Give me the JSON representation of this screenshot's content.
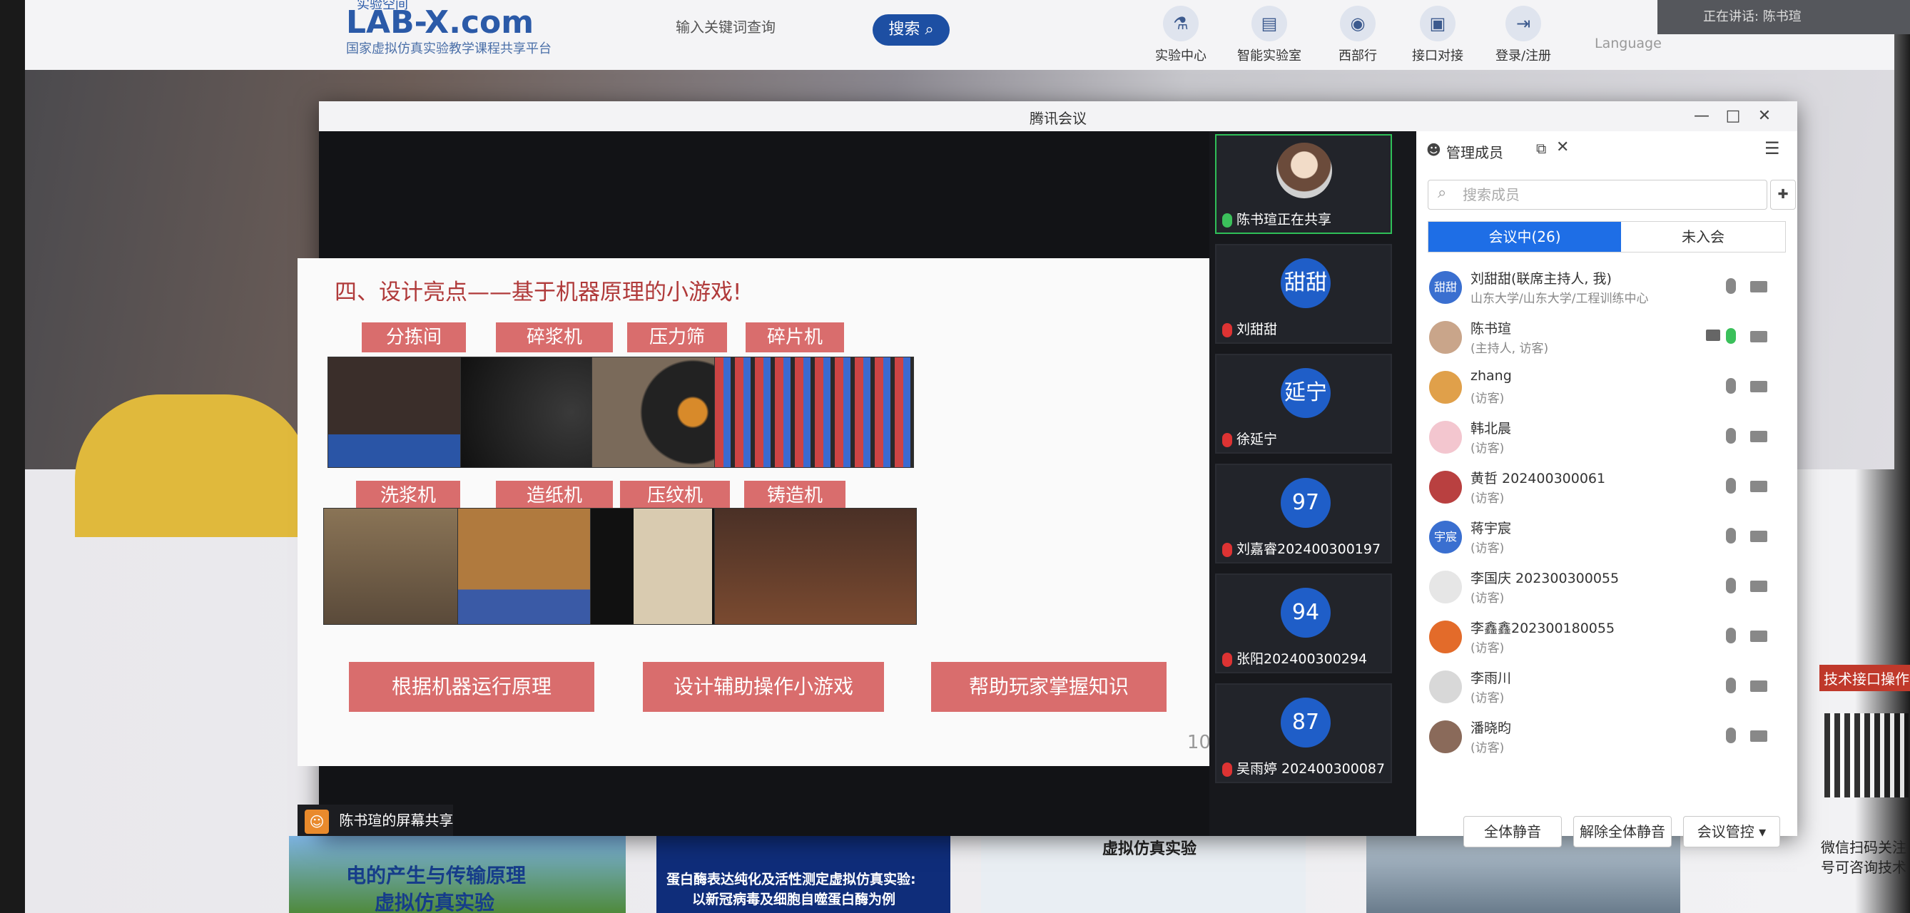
{
  "site": {
    "logo_top": "实验空间",
    "logo": "LAB-X.com",
    "logo_sub": "国家虚拟仿真实验教学课程共享平台",
    "search_placeholder": "输入关键词查询",
    "search_button": "搜索",
    "nav": [
      "实验中心",
      "智能实验室",
      "西部行",
      "接口对接",
      "登录/注册"
    ],
    "language": "Language",
    "live_text": "正在讲话: 陈书瑄",
    "cards": [
      {
        "line1": "电的产生与传输原理",
        "line2": "虚拟仿真实验"
      },
      {
        "line1": "蛋白酶表达纯化及活性测定虚拟仿真实验:",
        "line2": "以新冠病毒及细胞自噬蛋白酶为例"
      },
      {
        "line1": "虚拟仿真实验",
        "line2": ""
      }
    ],
    "right_strip": "技术接口操作说",
    "qr_caption_1": "微信扫码关注",
    "qr_caption_2": "号可咨询技术"
  },
  "meeting": {
    "window_title": "腾讯会议",
    "share_label": "陈书瑄的屏幕共享",
    "slide": {
      "title": "四、设计亮点——基于机器原理的小游戏!",
      "games": [
        "分拣间",
        "碎浆机",
        "压力筛",
        "碎片机",
        "洗浆机",
        "造纸机",
        "压纹机",
        "铸造机"
      ],
      "footer_buttons": [
        "根据机器运行原理",
        "设计辅助操作小游戏",
        "帮助玩家掌握知识"
      ],
      "page": "10"
    },
    "tiles": [
      {
        "avatar": "",
        "name": "陈书瑄正在共享",
        "mic_on": true
      },
      {
        "avatar": "甜甜",
        "name": "刘甜甜",
        "mic_on": false
      },
      {
        "avatar": "延宁",
        "name": "徐延宁",
        "mic_on": false
      },
      {
        "avatar": "97",
        "name": "刘嘉睿202400300197",
        "mic_on": false
      },
      {
        "avatar": "94",
        "name": "张阳202400300294",
        "mic_on": false
      },
      {
        "avatar": "87",
        "name": "吴雨婷 202400300087",
        "mic_on": false
      }
    ],
    "members_panel": {
      "title": "管理成员",
      "search_placeholder": "搜索成员",
      "tab_in": "会议中(26)",
      "tab_out": "未入会",
      "members": [
        {
          "avatar": "甜甜",
          "name": "刘甜甜(联席主持人, 我)",
          "role": "山东大学/山东大学/工程训练中心",
          "mic_on": false
        },
        {
          "avatar": "",
          "name": "陈书瑄",
          "role": "(主持人, 访客)",
          "mic_on": true
        },
        {
          "avatar": "",
          "name": "zhang",
          "role": "(访客)",
          "mic_on": false
        },
        {
          "avatar": "",
          "name": "韩北晨",
          "role": "(访客)",
          "mic_on": false
        },
        {
          "avatar": "",
          "name": "黄哲 202400300061",
          "role": "(访客)",
          "mic_on": false
        },
        {
          "avatar": "宇宸",
          "name": "蒋宇宸",
          "role": "(访客)",
          "mic_on": false
        },
        {
          "avatar": "",
          "name": "李国庆  202300300055",
          "role": "(访客)",
          "mic_on": false
        },
        {
          "avatar": "",
          "name": "李鑫鑫202300180055",
          "role": "(访客)",
          "mic_on": false
        },
        {
          "avatar": "",
          "name": "李雨川",
          "role": "(访客)",
          "mic_on": false
        },
        {
          "avatar": "",
          "name": "潘晓昀",
          "role": "(访客)",
          "mic_on": false
        }
      ],
      "buttons": [
        "全体静音",
        "解除全体静音",
        "会议管控 ▾"
      ]
    }
  }
}
